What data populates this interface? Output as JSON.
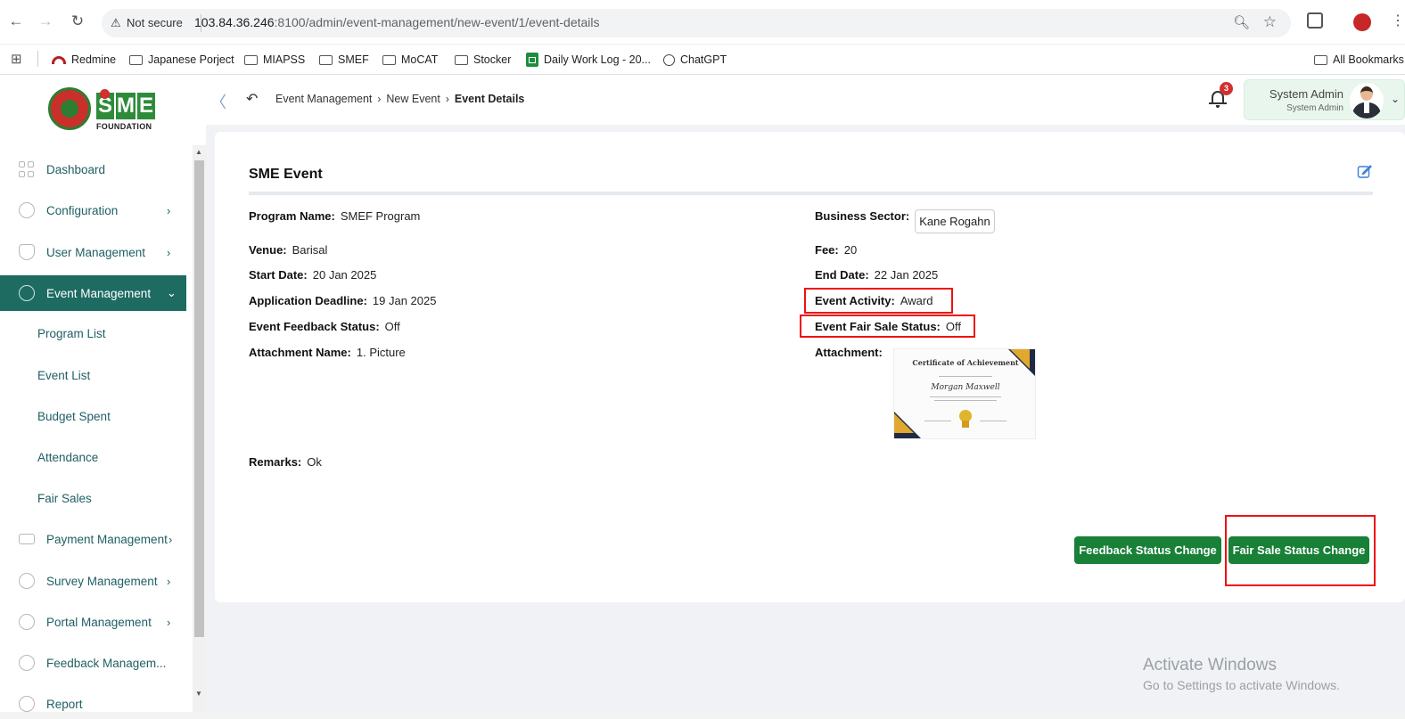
{
  "browser": {
    "security_label": "Not secure",
    "url_host": "103.84.36.246",
    "url_rest": ":8100/admin/event-management/new-event/1/event-details",
    "bookmarks": [
      {
        "label": "Redmine",
        "icon": "redmine-icon"
      },
      {
        "label": "Japanese Porject",
        "icon": "folder-icon"
      },
      {
        "label": "MIAPSS",
        "icon": "folder-icon"
      },
      {
        "label": "SMEF",
        "icon": "folder-icon"
      },
      {
        "label": "MoCAT",
        "icon": "folder-icon"
      },
      {
        "label": "Stocker",
        "icon": "folder-icon"
      },
      {
        "label": "Daily Work Log - 20...",
        "icon": "sheets-icon"
      },
      {
        "label": "ChatGPT",
        "icon": "chatgpt-icon"
      }
    ],
    "all_bookmarks": "All Bookmarks"
  },
  "logo": {
    "letters": [
      "S",
      "M",
      "E"
    ],
    "foundation": "FOUNDATION"
  },
  "header": {
    "breadcrumb": [
      "Event Management",
      "New Event",
      "Event Details"
    ],
    "notification_count": "3",
    "user_name": "System Admin",
    "user_role": "System Admin"
  },
  "sidebar": {
    "items": [
      {
        "label": "Dashboard",
        "icon": "dashboard-icon",
        "has_caret": false
      },
      {
        "label": "Configuration",
        "icon": "settings-icon",
        "has_caret": true
      },
      {
        "label": "User Management",
        "icon": "shield-icon",
        "has_caret": true
      },
      {
        "label": "Event Management",
        "icon": "event-icon",
        "has_caret": true,
        "active": true
      },
      {
        "label": "Payment Management",
        "icon": "payment-icon",
        "has_caret": true
      },
      {
        "label": "Survey Management",
        "icon": "pie-chart-icon",
        "has_caret": true
      },
      {
        "label": "Portal Management",
        "icon": "portal-icon",
        "has_caret": true
      },
      {
        "label": "Feedback Managem...",
        "icon": "feedback-icon",
        "has_caret": false
      },
      {
        "label": "Report",
        "icon": "report-icon",
        "has_caret": false
      }
    ],
    "subitems": [
      "Program List",
      "Event List",
      "Budget Spent",
      "Attendance",
      "Fair Sales"
    ],
    "caret_right": "›",
    "caret_down": "⌄"
  },
  "details": {
    "title": "SME Event",
    "program_name": {
      "label": "Program Name:",
      "value": "SMEF Program"
    },
    "business_sector": {
      "label": "Business Sector:",
      "value": "Kane Rogahn"
    },
    "venue": {
      "label": "Venue:",
      "value": "Barisal"
    },
    "fee": {
      "label": "Fee:",
      "value": "20"
    },
    "start_date": {
      "label": "Start Date:",
      "value": "20 Jan 2025"
    },
    "end_date": {
      "label": "End Date:",
      "value": "22 Jan 2025"
    },
    "application_deadline": {
      "label": "Application Deadline:",
      "value": "19 Jan 2025"
    },
    "event_activity": {
      "label": "Event Activity:",
      "value": "Award"
    },
    "feedback_status": {
      "label": "Event Feedback Status:",
      "value": "Off"
    },
    "fair_sale_status": {
      "label": "Event Fair Sale Status:",
      "value": "Off"
    },
    "attachment_name": {
      "label": "Attachment Name:",
      "value": "1. Picture"
    },
    "attachment": {
      "label": "Attachment:"
    },
    "remarks": {
      "label": "Remarks:",
      "value": "Ok"
    }
  },
  "certificate": {
    "title": "Certificate of Achievement",
    "name": "Morgan Maxwell"
  },
  "actions": {
    "feedback_button": "Feedback Status Change",
    "fair_sale_button": "Fair Sale Status Change"
  },
  "watermark": {
    "line1": "Activate Windows",
    "line2": "Go to Settings to activate Windows."
  },
  "colors": {
    "sidebar_active": "#1e6b62",
    "button_green": "#198038",
    "highlight_red": "#e11111"
  }
}
